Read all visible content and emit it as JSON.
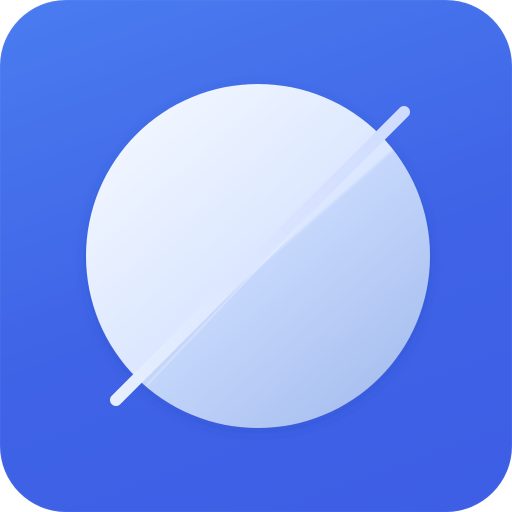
{
  "app_icon": {
    "name": "planet-browser-app-icon",
    "colors": {
      "tile_top": "#4a7cf0",
      "tile_bottom": "#3d5ee5",
      "sphere_light": "#eef4ff",
      "sphere_shade": "#b9cdf3",
      "ring": "#dce8ff"
    }
  }
}
